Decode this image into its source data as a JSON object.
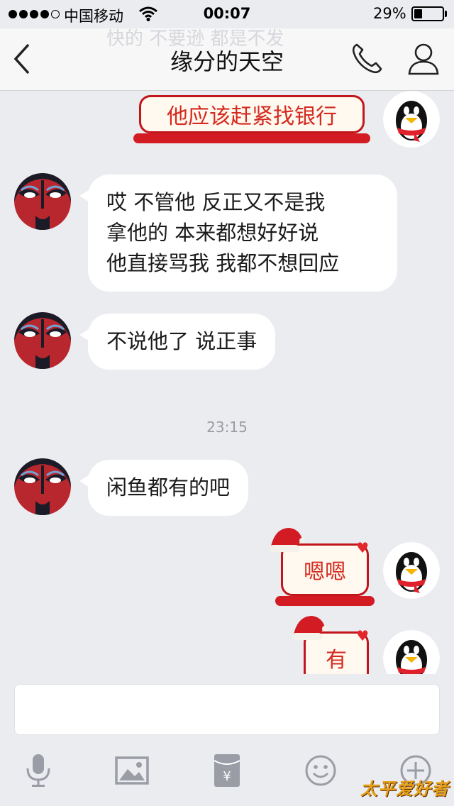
{
  "status_bar": {
    "carrier": "中国移动",
    "time": "00:07",
    "battery_percent": "29%",
    "battery_level": 0.29,
    "signal_bars_filled": 4,
    "signal_bars_total": 5
  },
  "header": {
    "ghost_text": "快的 不要逊 都是不发",
    "title": "缘分的天空",
    "back_icon": "chevron-left-icon",
    "call_icon": "phone-icon",
    "profile_icon": "user-icon"
  },
  "messages": [
    {
      "side": "right",
      "style": "festive",
      "text": "他应该赶紧找银行"
    },
    {
      "side": "left",
      "style": "plain",
      "lines": [
        "哎 不管他 反正又不是我",
        "拿他的 本来都想好好说",
        "他直接骂我 我都不想回应"
      ]
    },
    {
      "side": "left",
      "style": "plain",
      "text": "不说他了 说正事"
    },
    {
      "side": "center",
      "style": "timestamp",
      "text": "23:15"
    },
    {
      "side": "left",
      "style": "plain",
      "text": "闲鱼都有的吧"
    },
    {
      "side": "right",
      "style": "festive",
      "text": "嗯嗯"
    },
    {
      "side": "right",
      "style": "festive",
      "text": "有"
    }
  ],
  "input": {
    "value": "",
    "placeholder": ""
  },
  "toolbar": {
    "icons": [
      "microphone-icon",
      "image-icon",
      "red-packet-icon",
      "emoji-icon",
      "plus-icon"
    ]
  },
  "watermark": "太平爱好者",
  "colors": {
    "background": "#ebecf0",
    "festive_red": "#d21b22",
    "festive_text": "#d42a1f"
  }
}
